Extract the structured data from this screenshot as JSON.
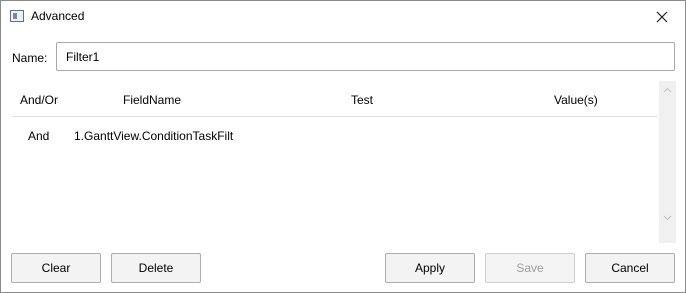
{
  "window": {
    "title": "Advanced",
    "icons": {
      "app": "window-app-icon",
      "close": "close-icon"
    }
  },
  "name_field": {
    "label": "Name:",
    "value": "Filter1"
  },
  "grid": {
    "columns": [
      "And/Or",
      "FieldName",
      "Test",
      "Value(s)"
    ],
    "rows": [
      {
        "and_or": "And",
        "field_name": "1.GanttView.ConditionTaskFilt",
        "test": "",
        "values": ""
      }
    ]
  },
  "buttons": {
    "clear": "Clear",
    "delete": "Delete",
    "apply": "Apply",
    "save": "Save",
    "cancel": "Cancel"
  },
  "state": {
    "save_enabled": false
  }
}
